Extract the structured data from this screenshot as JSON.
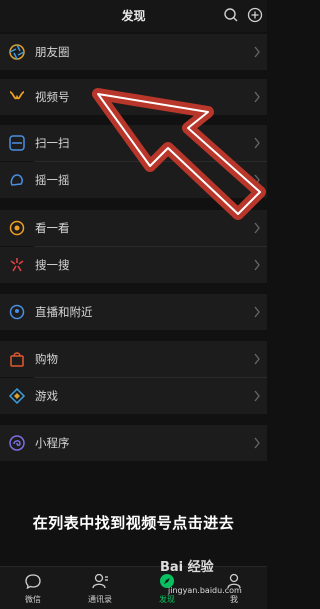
{
  "header": {
    "title": "发现",
    "search_icon": "search-icon",
    "add_icon": "add-circle-icon"
  },
  "menu": [
    {
      "label": "朋友圈",
      "icon": "moments-icon"
    },
    {
      "label": "视频号",
      "icon": "channels-icon"
    },
    {
      "label": "扫一扫",
      "icon": "scan-icon"
    },
    {
      "label": "摇一摇",
      "icon": "shake-icon"
    },
    {
      "label": "看一看",
      "icon": "top-stories-icon"
    },
    {
      "label": "搜一搜",
      "icon": "search-star-icon"
    },
    {
      "label": "直播和附近",
      "icon": "live-nearby-icon"
    },
    {
      "label": "购物",
      "icon": "shopping-bag-icon"
    },
    {
      "label": "游戏",
      "icon": "games-icon"
    },
    {
      "label": "小程序",
      "icon": "mini-programs-icon"
    }
  ],
  "caption": "在列表中找到视频号点击进去",
  "tabs": [
    {
      "label": "微信",
      "icon": "chat-icon"
    },
    {
      "label": "通讯录",
      "icon": "contacts-icon"
    },
    {
      "label": "发现",
      "icon": "discover-icon",
      "active": true
    },
    {
      "label": "我",
      "icon": "me-icon"
    }
  ],
  "watermark": {
    "text": "Bai 经验",
    "sub": "jingyan.baidu.com"
  },
  "colors": {
    "arrow": "#c0392b",
    "active_tab": "#07c160",
    "background": "#111111"
  }
}
